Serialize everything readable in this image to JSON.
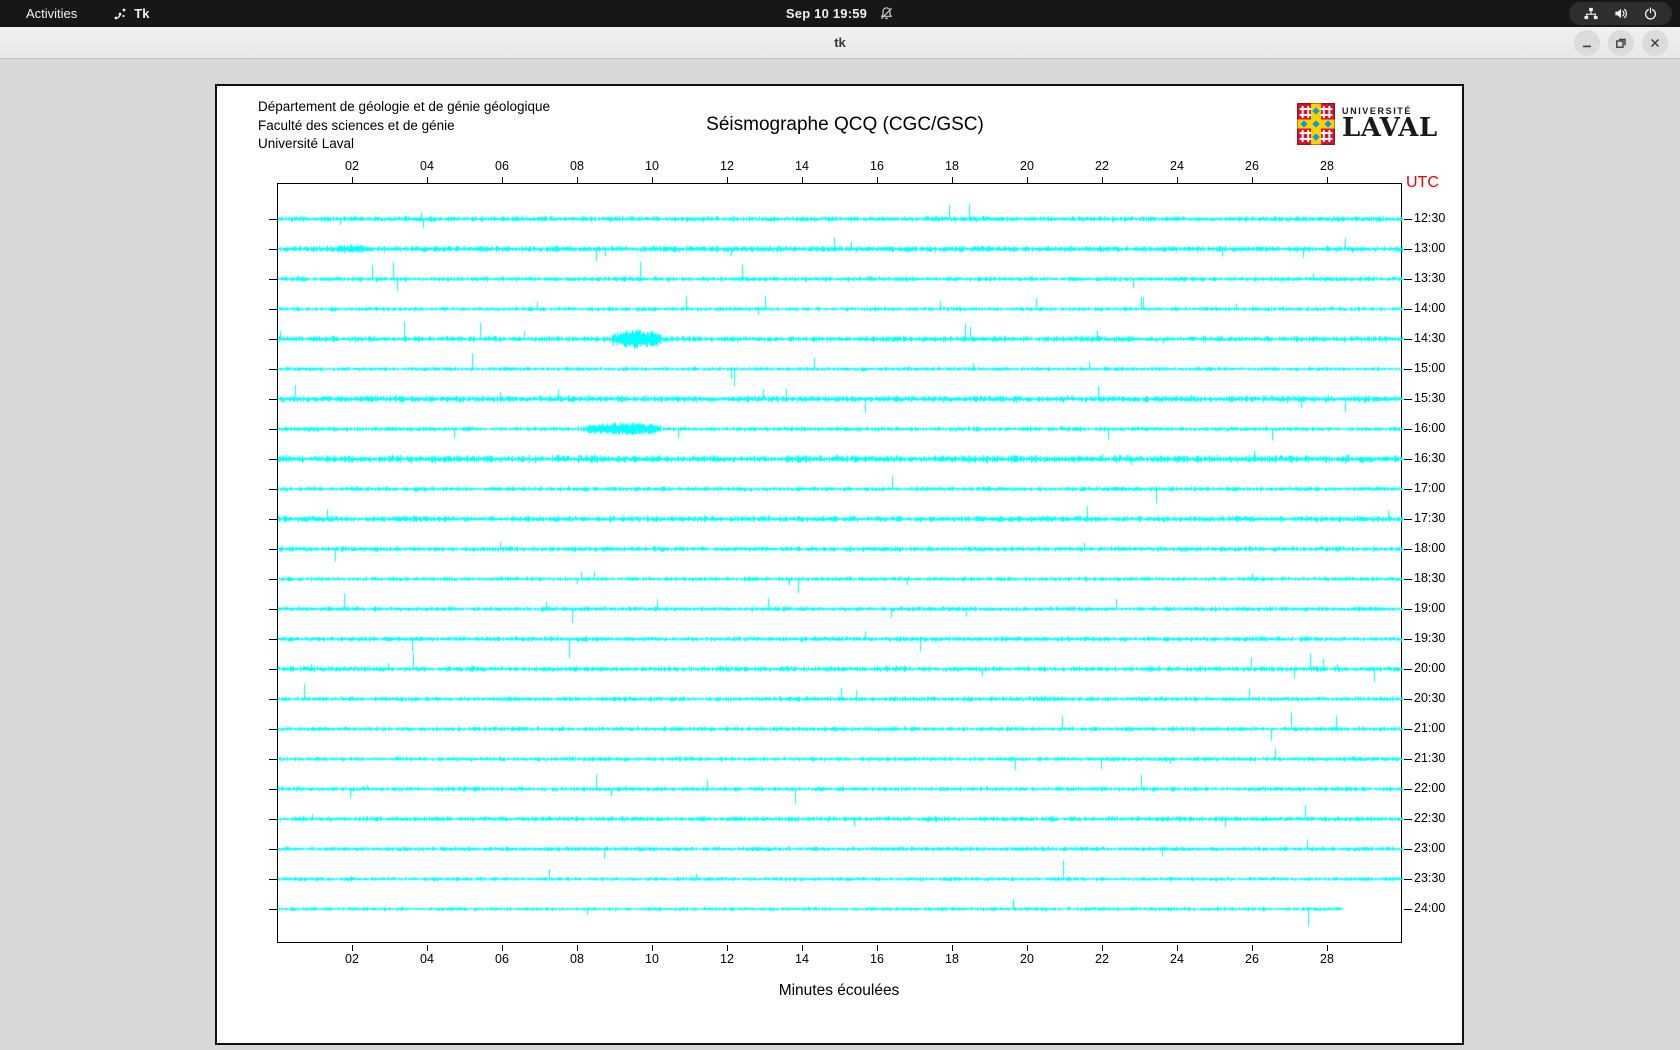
{
  "topbar": {
    "activities": "Activities",
    "app_name": "Tk",
    "clock": "Sep 10 19:59",
    "icons": [
      "tk-icon",
      "bell-slash-icon",
      "network-icon",
      "volume-icon",
      "power-icon"
    ]
  },
  "titlebar": {
    "title": "tk",
    "buttons": [
      "minimize",
      "maximize",
      "close"
    ]
  },
  "plot_header": {
    "address_lines": [
      "Département de géologie et de génie géologique",
      "Faculté des sciences et de génie",
      "Université Laval"
    ],
    "title": "Séismographe QCQ (CGC/GSC)",
    "logo_small": "UNIVERSITÉ",
    "logo_large": "LAVAL"
  },
  "chart_data": {
    "type": "line",
    "subtype": "helicorder-seismogram",
    "title": "Séismographe QCQ (CGC/GSC)",
    "xlabel": "Minutes écoulées",
    "y_axis_corner_label": "UTC",
    "x_range_minutes": [
      0,
      30
    ],
    "x_ticks": [
      "02",
      "04",
      "06",
      "08",
      "10",
      "12",
      "14",
      "16",
      "18",
      "20",
      "22",
      "24",
      "26",
      "28"
    ],
    "x_tick_minutes": [
      2,
      4,
      6,
      8,
      10,
      12,
      14,
      16,
      18,
      20,
      22,
      24,
      26,
      28
    ],
    "row_spacing_px": 30,
    "trace_color": "#00ffff",
    "frame_color": "#000000",
    "utc_label_color": "#f40000",
    "grid": false,
    "rows": [
      {
        "label": "12:30",
        "amp": 1.1,
        "spikes": 0.005,
        "spike_amp": 13,
        "end_min": 30,
        "bursts": []
      },
      {
        "label": "13:00",
        "amp": 1.25,
        "spikes": 0.006,
        "spike_amp": 11,
        "end_min": 30,
        "bursts": [
          {
            "s": 1.6,
            "e": 2.3,
            "a": 2.5
          }
        ]
      },
      {
        "label": "13:30",
        "amp": 1.0,
        "spikes": 0.006,
        "spike_amp": 15,
        "end_min": 30,
        "bursts": []
      },
      {
        "label": "14:00",
        "amp": 0.85,
        "spikes": 0.004,
        "spike_amp": 10,
        "end_min": 30,
        "bursts": []
      },
      {
        "label": "14:30",
        "amp": 1.2,
        "spikes": 0.006,
        "spike_amp": 13,
        "end_min": 30,
        "bursts": [
          {
            "s": 8.9,
            "e": 10.2,
            "a": 9
          }
        ]
      },
      {
        "label": "15:00",
        "amp": 0.85,
        "spikes": 0.005,
        "spike_amp": 12,
        "end_min": 30,
        "bursts": []
      },
      {
        "label": "15:30",
        "amp": 1.35,
        "spikes": 0.005,
        "spike_amp": 11,
        "end_min": 30,
        "bursts": []
      },
      {
        "label": "16:00",
        "amp": 0.95,
        "spikes": 0.005,
        "spike_amp": 12,
        "end_min": 30,
        "bursts": [
          {
            "s": 8.2,
            "e": 10.2,
            "a": 6
          }
        ]
      },
      {
        "label": "16:30",
        "amp": 1.5,
        "spikes": 0.006,
        "spike_amp": 12,
        "end_min": 30,
        "bursts": []
      },
      {
        "label": "17:00",
        "amp": 0.95,
        "spikes": 0.005,
        "spike_amp": 12,
        "end_min": 30,
        "bursts": []
      },
      {
        "label": "17:30",
        "amp": 1.25,
        "spikes": 0.005,
        "spike_amp": 13,
        "end_min": 30,
        "bursts": []
      },
      {
        "label": "18:00",
        "amp": 1.05,
        "spikes": 0.006,
        "spike_amp": 13,
        "end_min": 30,
        "bursts": []
      },
      {
        "label": "18:30",
        "amp": 0.9,
        "spikes": 0.004,
        "spike_amp": 10,
        "end_min": 30,
        "bursts": []
      },
      {
        "label": "19:00",
        "amp": 1.0,
        "spikes": 0.005,
        "spike_amp": 13,
        "end_min": 30,
        "bursts": []
      },
      {
        "label": "19:30",
        "amp": 1.05,
        "spikes": 0.006,
        "spike_amp": 15,
        "end_min": 30,
        "bursts": []
      },
      {
        "label": "20:00",
        "amp": 1.1,
        "spikes": 0.006,
        "spike_amp": 13,
        "end_min": 30,
        "bursts": []
      },
      {
        "label": "20:30",
        "amp": 1.0,
        "spikes": 0.005,
        "spike_amp": 12,
        "end_min": 30,
        "bursts": []
      },
      {
        "label": "21:00",
        "amp": 0.95,
        "spikes": 0.005,
        "spike_amp": 13,
        "end_min": 30,
        "bursts": []
      },
      {
        "label": "21:30",
        "amp": 0.95,
        "spikes": 0.005,
        "spike_amp": 12,
        "end_min": 30,
        "bursts": []
      },
      {
        "label": "22:00",
        "amp": 0.95,
        "spikes": 0.005,
        "spike_amp": 12,
        "end_min": 30,
        "bursts": []
      },
      {
        "label": "22:30",
        "amp": 1.05,
        "spikes": 0.005,
        "spike_amp": 15,
        "end_min": 30,
        "bursts": []
      },
      {
        "label": "23:00",
        "amp": 0.95,
        "spikes": 0.005,
        "spike_amp": 13,
        "end_min": 30,
        "bursts": []
      },
      {
        "label": "23:30",
        "amp": 0.85,
        "spikes": 0.004,
        "spike_amp": 17,
        "end_min": 30,
        "bursts": []
      },
      {
        "label": "24:00",
        "amp": 0.8,
        "spikes": 0.004,
        "spike_amp": 13,
        "end_min": 28.4,
        "bursts": []
      }
    ]
  }
}
